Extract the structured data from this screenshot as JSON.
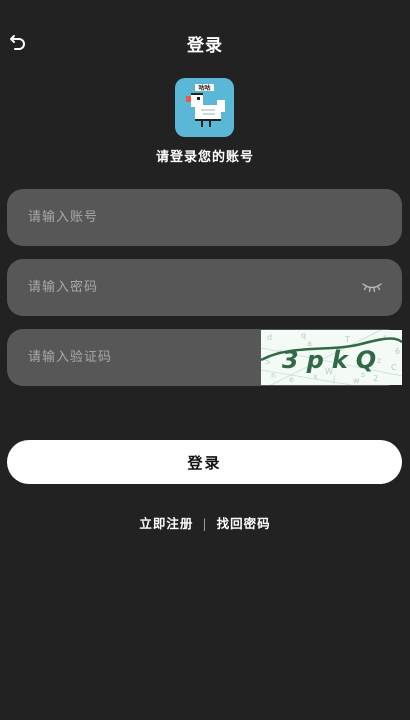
{
  "header": {
    "title": "登录",
    "back_icon": "back-arrow-icon"
  },
  "logo": {
    "badge_text": "咕咕",
    "icon": "pixel-pigeon-icon",
    "background": "#5ab7d6"
  },
  "subtitle": "请登录您的账号",
  "form": {
    "account_placeholder": "请输入账号",
    "account_value": "",
    "password_placeholder": "请输入密码",
    "password_value": "",
    "password_visibility_icon": "eye-closed-icon",
    "captcha_placeholder": "请输入验证码",
    "captcha_value": "",
    "captcha_image_text": "3pkQ"
  },
  "login_button": "登录",
  "links": {
    "register": "立即注册",
    "separator": "|",
    "forgot": "找回密码"
  },
  "colors": {
    "background": "#222222",
    "field_background": "#575757",
    "placeholder": "#a9a9a9",
    "button_background": "#ffffff",
    "captcha_ink": "#2e6a45"
  }
}
